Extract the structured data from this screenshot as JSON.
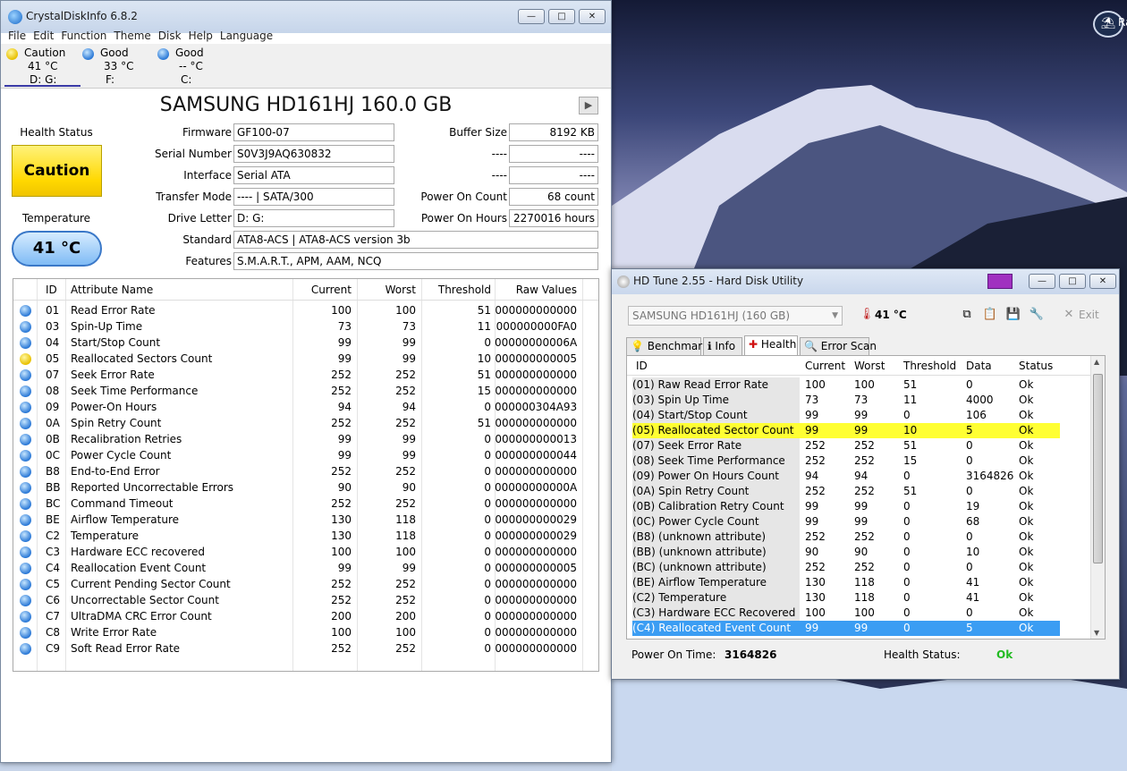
{
  "desktop": {
    "icon_label": "Ra"
  },
  "cdi": {
    "title": "CrystalDiskInfo 6.8.2",
    "window_buttons": [
      "—",
      "□",
      "✕"
    ],
    "menu": [
      "File",
      "Edit",
      "Function",
      "Theme",
      "Disk",
      "Help",
      "Language"
    ],
    "disks": [
      {
        "status": "Caution",
        "temp": "41 °C",
        "letters": "D: G:",
        "color": "yellow"
      },
      {
        "status": "Good",
        "temp": "33 °C",
        "letters": "F:",
        "color": "blue"
      },
      {
        "status": "Good",
        "temp": "-- °C",
        "letters": "C:",
        "color": "blue"
      }
    ],
    "model": "SAMSUNG HD161HJ 160.0 GB",
    "health_label": "Health Status",
    "health_value": "Caution",
    "temp_label": "Temperature",
    "temp_value": "41 °C",
    "fields": {
      "firmware_label": "Firmware",
      "firmware": "GF100-07",
      "serial_label": "Serial Number",
      "serial": "S0V3J9AQ630832",
      "interface_label": "Interface",
      "interface": "Serial ATA",
      "transfer_label": "Transfer Mode",
      "transfer": "---- | SATA/300",
      "letter_label": "Drive Letter",
      "letter": "D: G:",
      "standard_label": "Standard",
      "standard": "ATA8-ACS | ATA8-ACS version 3b",
      "features_label": "Features",
      "features": "S.M.A.R.T., APM, AAM, NCQ",
      "buffer_label": "Buffer Size",
      "buffer": "8192 KB",
      "blank1_label": "----",
      "blank1": "----",
      "blank2_label": "----",
      "blank2": "----",
      "poc_label": "Power On Count",
      "poc": "68 count",
      "poh_label": "Power On Hours",
      "poh": "2270016 hours"
    },
    "smart_headers": [
      "ID",
      "Attribute Name",
      "Current",
      "Worst",
      "Threshold",
      "Raw Values"
    ],
    "smart_rows": [
      {
        "id": "01",
        "name": "Read Error Rate",
        "cur": "100",
        "worst": "100",
        "thr": "51",
        "raw": "000000000000",
        "c": "blue"
      },
      {
        "id": "03",
        "name": "Spin-Up Time",
        "cur": "73",
        "worst": "73",
        "thr": "11",
        "raw": "000000000FA0",
        "c": "blue"
      },
      {
        "id": "04",
        "name": "Start/Stop Count",
        "cur": "99",
        "worst": "99",
        "thr": "0",
        "raw": "00000000006A",
        "c": "blue"
      },
      {
        "id": "05",
        "name": "Reallocated Sectors Count",
        "cur": "99",
        "worst": "99",
        "thr": "10",
        "raw": "000000000005",
        "c": "yellow"
      },
      {
        "id": "07",
        "name": "Seek Error Rate",
        "cur": "252",
        "worst": "252",
        "thr": "51",
        "raw": "000000000000",
        "c": "blue"
      },
      {
        "id": "08",
        "name": "Seek Time Performance",
        "cur": "252",
        "worst": "252",
        "thr": "15",
        "raw": "000000000000",
        "c": "blue"
      },
      {
        "id": "09",
        "name": "Power-On Hours",
        "cur": "94",
        "worst": "94",
        "thr": "0",
        "raw": "000000304A93",
        "c": "blue"
      },
      {
        "id": "0A",
        "name": "Spin Retry Count",
        "cur": "252",
        "worst": "252",
        "thr": "51",
        "raw": "000000000000",
        "c": "blue"
      },
      {
        "id": "0B",
        "name": "Recalibration Retries",
        "cur": "99",
        "worst": "99",
        "thr": "0",
        "raw": "000000000013",
        "c": "blue"
      },
      {
        "id": "0C",
        "name": "Power Cycle Count",
        "cur": "99",
        "worst": "99",
        "thr": "0",
        "raw": "000000000044",
        "c": "blue"
      },
      {
        "id": "B8",
        "name": "End-to-End Error",
        "cur": "252",
        "worst": "252",
        "thr": "0",
        "raw": "000000000000",
        "c": "blue"
      },
      {
        "id": "BB",
        "name": "Reported Uncorrectable Errors",
        "cur": "90",
        "worst": "90",
        "thr": "0",
        "raw": "00000000000A",
        "c": "blue"
      },
      {
        "id": "BC",
        "name": "Command Timeout",
        "cur": "252",
        "worst": "252",
        "thr": "0",
        "raw": "000000000000",
        "c": "blue"
      },
      {
        "id": "BE",
        "name": "Airflow Temperature",
        "cur": "130",
        "worst": "118",
        "thr": "0",
        "raw": "000000000029",
        "c": "blue"
      },
      {
        "id": "C2",
        "name": "Temperature",
        "cur": "130",
        "worst": "118",
        "thr": "0",
        "raw": "000000000029",
        "c": "blue"
      },
      {
        "id": "C3",
        "name": "Hardware ECC recovered",
        "cur": "100",
        "worst": "100",
        "thr": "0",
        "raw": "000000000000",
        "c": "blue"
      },
      {
        "id": "C4",
        "name": "Reallocation Event Count",
        "cur": "99",
        "worst": "99",
        "thr": "0",
        "raw": "000000000005",
        "c": "blue"
      },
      {
        "id": "C5",
        "name": "Current Pending Sector Count",
        "cur": "252",
        "worst": "252",
        "thr": "0",
        "raw": "000000000000",
        "c": "blue"
      },
      {
        "id": "C6",
        "name": "Uncorrectable Sector Count",
        "cur": "252",
        "worst": "252",
        "thr": "0",
        "raw": "000000000000",
        "c": "blue"
      },
      {
        "id": "C7",
        "name": "UltraDMA CRC Error Count",
        "cur": "200",
        "worst": "200",
        "thr": "0",
        "raw": "000000000000",
        "c": "blue"
      },
      {
        "id": "C8",
        "name": "Write Error Rate",
        "cur": "100",
        "worst": "100",
        "thr": "0",
        "raw": "000000000000",
        "c": "blue"
      },
      {
        "id": "C9",
        "name": "Soft Read Error Rate",
        "cur": "252",
        "worst": "252",
        "thr": "0",
        "raw": "000000000000",
        "c": "blue"
      }
    ]
  },
  "hdt": {
    "title": "HD Tune 2.55 - Hard Disk Utility",
    "window_buttons": [
      "—",
      "□",
      "✕"
    ],
    "drive": "SAMSUNG HD161HJ (160 GB)",
    "temp": "41 °C",
    "exit_label": "Exit",
    "tabs": [
      "Benchmark",
      "Info",
      "Health",
      "Error Scan"
    ],
    "headers": [
      "ID",
      "Current",
      "Worst",
      "Threshold",
      "Data",
      "Status"
    ],
    "rows": [
      {
        "id": "(01) Raw Read Error Rate",
        "cur": "100",
        "worst": "100",
        "thr": "51",
        "data": "0",
        "status": "Ok",
        "hl": ""
      },
      {
        "id": "(03) Spin Up Time",
        "cur": "73",
        "worst": "73",
        "thr": "11",
        "data": "4000",
        "status": "Ok",
        "hl": ""
      },
      {
        "id": "(04) Start/Stop Count",
        "cur": "99",
        "worst": "99",
        "thr": "0",
        "data": "106",
        "status": "Ok",
        "hl": ""
      },
      {
        "id": "(05) Reallocated Sector Count",
        "cur": "99",
        "worst": "99",
        "thr": "10",
        "data": "5",
        "status": "Ok",
        "hl": "yellow"
      },
      {
        "id": "(07) Seek Error Rate",
        "cur": "252",
        "worst": "252",
        "thr": "51",
        "data": "0",
        "status": "Ok",
        "hl": ""
      },
      {
        "id": "(08) Seek Time Performance",
        "cur": "252",
        "worst": "252",
        "thr": "15",
        "data": "0",
        "status": "Ok",
        "hl": ""
      },
      {
        "id": "(09) Power On Hours Count",
        "cur": "94",
        "worst": "94",
        "thr": "0",
        "data": "3164826",
        "status": "Ok",
        "hl": ""
      },
      {
        "id": "(0A) Spin Retry Count",
        "cur": "252",
        "worst": "252",
        "thr": "51",
        "data": "0",
        "status": "Ok",
        "hl": ""
      },
      {
        "id": "(0B) Calibration Retry Count",
        "cur": "99",
        "worst": "99",
        "thr": "0",
        "data": "19",
        "status": "Ok",
        "hl": ""
      },
      {
        "id": "(0C) Power Cycle Count",
        "cur": "99",
        "worst": "99",
        "thr": "0",
        "data": "68",
        "status": "Ok",
        "hl": ""
      },
      {
        "id": "(B8) (unknown attribute)",
        "cur": "252",
        "worst": "252",
        "thr": "0",
        "data": "0",
        "status": "Ok",
        "hl": ""
      },
      {
        "id": "(BB) (unknown attribute)",
        "cur": "90",
        "worst": "90",
        "thr": "0",
        "data": "10",
        "status": "Ok",
        "hl": ""
      },
      {
        "id": "(BC) (unknown attribute)",
        "cur": "252",
        "worst": "252",
        "thr": "0",
        "data": "0",
        "status": "Ok",
        "hl": ""
      },
      {
        "id": "(BE) Airflow Temperature",
        "cur": "130",
        "worst": "118",
        "thr": "0",
        "data": "41",
        "status": "Ok",
        "hl": ""
      },
      {
        "id": "(C2) Temperature",
        "cur": "130",
        "worst": "118",
        "thr": "0",
        "data": "41",
        "status": "Ok",
        "hl": ""
      },
      {
        "id": "(C3) Hardware ECC Recovered",
        "cur": "100",
        "worst": "100",
        "thr": "0",
        "data": "0",
        "status": "Ok",
        "hl": ""
      },
      {
        "id": "(C4) Reallocated Event Count",
        "cur": "99",
        "worst": "99",
        "thr": "0",
        "data": "5",
        "status": "Ok",
        "hl": "blue"
      }
    ],
    "power_on_label": "Power On Time:",
    "power_on_value": "3164826",
    "health_label": "Health Status:",
    "health_value": "Ok",
    "ok_color": "#22bb22"
  }
}
